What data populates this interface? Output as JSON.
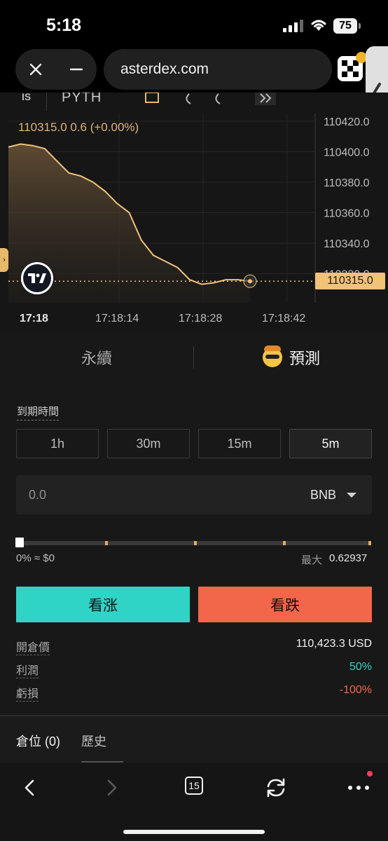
{
  "status_bar": {
    "time": "5:18",
    "battery": "75"
  },
  "browser": {
    "url": "asterdex.com",
    "tabs_count": "15"
  },
  "chart": {
    "toolbar_left": "IS",
    "toolbar_provider": "PYTH",
    "price_info": "110315.0  0.6 (+0.00%)",
    "last_price_label": "110315.0",
    "x_first": "17:18"
  },
  "chart_data": {
    "type": "area",
    "x": [
      "17:18:00",
      "17:18:02",
      "17:18:04",
      "17:18:06",
      "17:18:08",
      "17:18:10",
      "17:18:12",
      "17:18:14",
      "17:18:16",
      "17:18:18",
      "17:18:20",
      "17:18:22",
      "17:18:24",
      "17:18:26",
      "17:18:28",
      "17:18:30",
      "17:18:32",
      "17:18:34",
      "17:18:36",
      "17:18:38",
      "17:18:40"
    ],
    "values": [
      110403,
      110405,
      110404,
      110402,
      110394,
      110386,
      110384,
      110380,
      110374,
      110366,
      110360,
      110342,
      110332,
      110328,
      110324,
      110316,
      110313,
      110314,
      110316,
      110316,
      110315
    ],
    "ylim": [
      110311,
      110425
    ],
    "y_ticks": [
      "110420.0",
      "110400.0",
      "110380.0",
      "110360.0",
      "110340.0",
      "110320.0"
    ],
    "x_ticks": [
      "17:18:14",
      "17:18:28",
      "17:18:42"
    ],
    "last_price": 110315.0,
    "line_color": "#f0c27a",
    "grid": true
  },
  "panel": {
    "tab_perpetual": "永續",
    "tab_prediction": "預測",
    "expiry_label": "到期時間",
    "expiry_options": [
      "1h",
      "30m",
      "15m",
      "5m"
    ],
    "amount_value": "0.0",
    "amount_unit": "BNB",
    "slider_value": 0,
    "slider_left_text": "0% ≈ $0",
    "slider_max_label": "最大",
    "slider_max_value": "0.62937",
    "btn_long": "看涨",
    "btn_short": "看跌",
    "open_price_label": "開倉價",
    "open_price_value": "110,423.3 USD",
    "profit_label": "利潤",
    "profit_value": "50%",
    "loss_label": "虧損",
    "loss_value": "-100%"
  },
  "positions": {
    "tab_positions": "倉位 (0)",
    "tab_history": "歷史"
  },
  "colors": {
    "long": "#2fd4c6",
    "short": "#f2674a",
    "accent": "#f0c27a"
  }
}
